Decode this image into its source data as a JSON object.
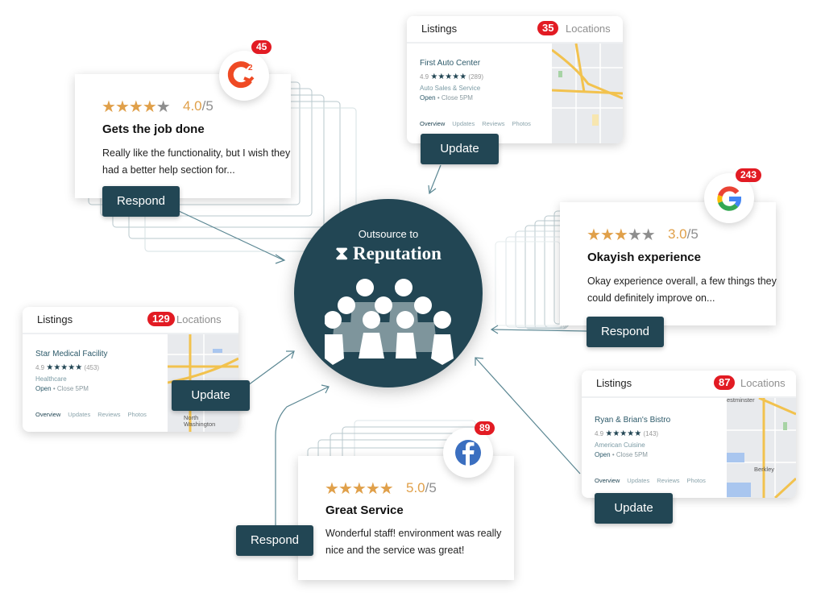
{
  "center": {
    "subtitle": "Outsource to",
    "brand": "Reputation",
    "brand_color": "#224654"
  },
  "reviews": [
    {
      "id": "g2",
      "source": "G2",
      "source_icon": "g2-logo-icon",
      "count": "45",
      "stars": 4,
      "score": "4.0",
      "max": "/5",
      "title": "Gets the job done",
      "body": "Really like the functionality, but I wish they had a better help section for...",
      "button": "Respond"
    },
    {
      "id": "google",
      "source": "Google",
      "source_icon": "google-logo-icon",
      "count": "243",
      "stars": 3,
      "score": "3.0",
      "max": "/5",
      "title": "Okayish experience",
      "body": "Okay experience overall, a few things they could definitely improve on...",
      "button": "Respond"
    },
    {
      "id": "facebook",
      "source": "Facebook",
      "source_icon": "facebook-logo-icon",
      "count": "89",
      "stars": 5,
      "score": "5.0",
      "max": "/5",
      "title": "Great Service",
      "body": "Wonderful staff! environment was really nice and the service was great!",
      "button": "Respond"
    }
  ],
  "listings": [
    {
      "id": "auto",
      "header": "Listings",
      "count": "35",
      "locations": "Locations",
      "business": "First Auto Center",
      "rating": "4.9",
      "reviews": "(289)",
      "category": "Auto Sales & Service",
      "open": "Open",
      "hours": "• Close 5PM",
      "tabs": [
        "Overview",
        "Updates",
        "Reviews",
        "Photos"
      ],
      "button": "Update",
      "map_label": ""
    },
    {
      "id": "medical",
      "header": "Listings",
      "count": "129",
      "locations": "Locations",
      "business": "Star Medical Facility",
      "rating": "4.9",
      "reviews": "(453)",
      "category": "Healthcare",
      "open": "Open",
      "hours": "• Close 5PM",
      "tabs": [
        "Overview",
        "Updates",
        "Reviews",
        "Photos"
      ],
      "button": "Update",
      "map_label": "North Washington"
    },
    {
      "id": "bistro",
      "header": "Listings",
      "count": "87",
      "locations": "Locations",
      "business": "Ryan & Brian's Bistro",
      "rating": "4.9",
      "reviews": "(143)",
      "category": "American Cuisine",
      "open": "Open",
      "hours": "• Close 5PM",
      "tabs": [
        "Overview",
        "Updates",
        "Reviews",
        "Photos"
      ],
      "button": "Update",
      "map_label": "Berkley",
      "map_label2": "estminster"
    }
  ],
  "star_glyph": "★"
}
